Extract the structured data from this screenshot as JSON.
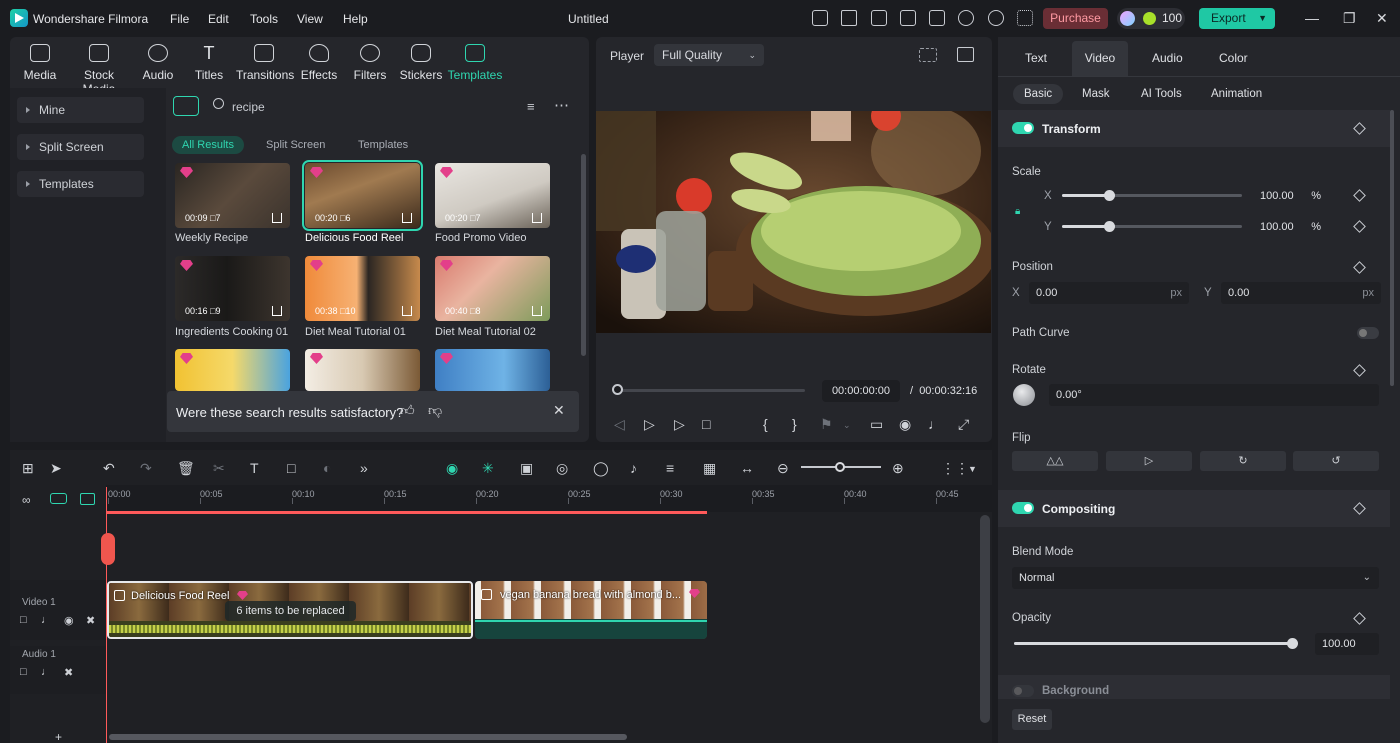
{
  "app": {
    "name": "Wondershare Filmora",
    "title": "Untitled"
  },
  "menu": [
    "File",
    "Edit",
    "Tools",
    "View",
    "Help"
  ],
  "topbar": {
    "purchase": "Purchase",
    "credits": "100",
    "export": "Export"
  },
  "media_tabs": [
    "Media",
    "Stock Media",
    "Audio",
    "Titles",
    "Transitions",
    "Effects",
    "Filters",
    "Stickers",
    "Templates"
  ],
  "left_nav": [
    "Mine",
    "Split Screen",
    "Templates"
  ],
  "search": {
    "value": "recipe"
  },
  "filters": [
    "All Results",
    "Split Screen",
    "Templates"
  ],
  "templates": [
    {
      "label": "Weekly Recipe",
      "duration": "00:09",
      "count": "7"
    },
    {
      "label": "Delicious Food Reel",
      "duration": "00:20",
      "count": "6"
    },
    {
      "label": "Food Promo Video",
      "duration": "00:20",
      "count": "7"
    },
    {
      "label": "Ingredients Cooking 01",
      "duration": "00:16",
      "count": "9"
    },
    {
      "label": "Diet Meal Tutorial 01",
      "duration": "00:38",
      "count": "10"
    },
    {
      "label": "Diet Meal Tutorial 02",
      "duration": "00:40",
      "count": "8"
    }
  ],
  "feedback": {
    "question": "Were these search results satisfactory?"
  },
  "player": {
    "label": "Player",
    "quality": "Full Quality",
    "current": "00:00:00:00",
    "separator": "/",
    "total": "00:00:32:16"
  },
  "props": {
    "tabs": [
      "Text",
      "Video",
      "Audio",
      "Color"
    ],
    "subtabs": [
      "Basic",
      "Mask",
      "AI Tools",
      "Animation"
    ],
    "transform": "Transform",
    "scale": "Scale",
    "scale_x": "100.00",
    "scale_y": "100.00",
    "scale_unit": "%",
    "x": "X",
    "y": "Y",
    "position": "Position",
    "pos_x": "0.00",
    "pos_y": "0.00",
    "px": "px",
    "path_curve": "Path Curve",
    "rotate": "Rotate",
    "rotate_val": "0.00°",
    "flip": "Flip",
    "compositing": "Compositing",
    "blend_mode": "Blend Mode",
    "blend_value": "Normal",
    "opacity": "Opacity",
    "opacity_val": "100.00",
    "background": "Background",
    "reset": "Reset"
  },
  "timeline": {
    "ticks": [
      "00:00",
      "00:05",
      "00:10",
      "00:15",
      "00:20",
      "00:25",
      "00:30",
      "00:35",
      "00:40",
      "00:45"
    ],
    "tracks": {
      "video": "Video 1",
      "audio": "Audio 1"
    },
    "clip1": "Delicious Food Reel",
    "clip1_note": "6 items to be replaced",
    "clip2": "vegan banana bread with almond b..."
  },
  "colors": {
    "accent": "#2fd6b0",
    "playhead": "#ff5a5a",
    "purchase": "#6a2e35"
  }
}
